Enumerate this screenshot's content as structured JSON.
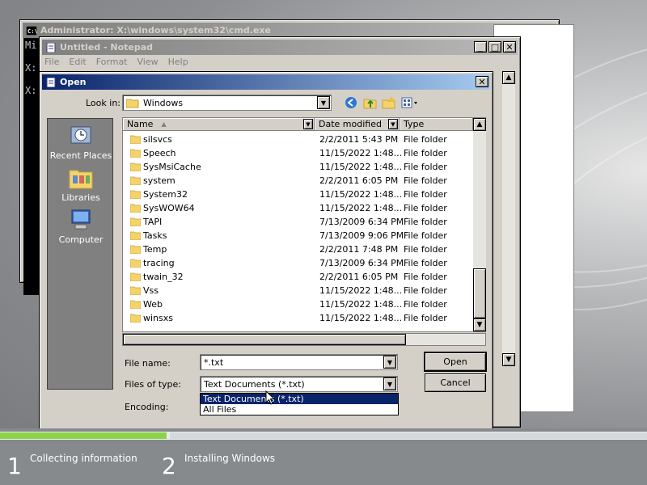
{
  "setup": {
    "steps": [
      {
        "number": "1",
        "label": "Collecting information"
      },
      {
        "number": "2",
        "label": "Installing Windows"
      }
    ],
    "colors": {
      "progress_done": "#8dd34a",
      "background": "#8c8e91"
    }
  },
  "cmd": {
    "title": "Administrator: X:\\windows\\system32\\cmd.exe",
    "lines": [
      "Mi",
      "",
      "X:",
      "",
      "X:"
    ]
  },
  "notepad": {
    "title": "Untitled - Notepad",
    "menu": [
      "File",
      "Edit",
      "Format",
      "View",
      "Help"
    ]
  },
  "dialog": {
    "title": "Open",
    "look_in_label": "Look in:",
    "look_in_value": "Windows",
    "places": [
      "Recent Places",
      "Libraries",
      "Computer"
    ],
    "columns": [
      "Name",
      "Date modified",
      "Type"
    ],
    "files": [
      {
        "name": "silsvcs",
        "date": "2/2/2011 5:43 PM",
        "type": "File folder"
      },
      {
        "name": "Speech",
        "date": "11/15/2022 1:48...",
        "type": "File folder"
      },
      {
        "name": "SysMsiCache",
        "date": "11/15/2022 1:48...",
        "type": "File folder"
      },
      {
        "name": "system",
        "date": "2/2/2011 6:05 PM",
        "type": "File folder"
      },
      {
        "name": "System32",
        "date": "11/15/2022 1:48...",
        "type": "File folder"
      },
      {
        "name": "SysWOW64",
        "date": "11/15/2022 1:48...",
        "type": "File folder"
      },
      {
        "name": "TAPI",
        "date": "7/13/2009 6:34 PM",
        "type": "File folder"
      },
      {
        "name": "Tasks",
        "date": "7/13/2009 9:06 PM",
        "type": "File folder"
      },
      {
        "name": "Temp",
        "date": "2/2/2011 7:48 PM",
        "type": "File folder"
      },
      {
        "name": "tracing",
        "date": "7/13/2009 6:34 PM",
        "type": "File folder"
      },
      {
        "name": "twain_32",
        "date": "2/2/2011 6:05 PM",
        "type": "File folder"
      },
      {
        "name": "Vss",
        "date": "11/15/2022 1:48...",
        "type": "File folder"
      },
      {
        "name": "Web",
        "date": "11/15/2022 1:48...",
        "type": "File folder"
      },
      {
        "name": "winsxs",
        "date": "11/15/2022 1:48...",
        "type": "File folder"
      }
    ],
    "file_name_label": "File name:",
    "file_name_value": "*.txt",
    "file_type_label": "Files of type:",
    "file_type_value": "Text Documents (*.txt)",
    "file_type_options": [
      "Text Documents (*.txt)",
      "All Files"
    ],
    "encoding_label": "Encoding:",
    "open_button": "Open",
    "cancel_button": "Cancel"
  }
}
